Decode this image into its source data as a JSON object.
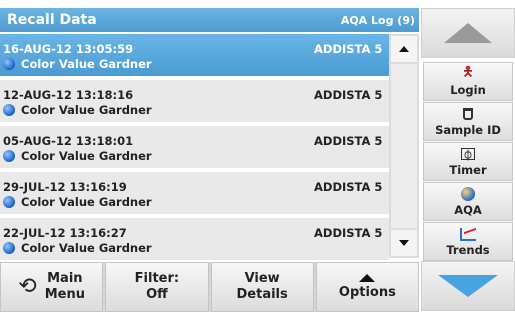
{
  "header": {
    "title": "Recall Data",
    "log": "AQA Log (9)"
  },
  "rows": [
    {
      "date": "16-AUG-12  13:05:59",
      "param": "Color Value Gardner",
      "sample": "ADDISTA 5",
      "selected": true
    },
    {
      "date": "12-AUG-12  13:18:16",
      "param": "Color Value Gardner",
      "sample": "ADDISTA 5",
      "selected": false
    },
    {
      "date": "05-AUG-12  13:18:01",
      "param": "Color Value Gardner",
      "sample": "ADDISTA 5",
      "selected": false
    },
    {
      "date": "29-JUL-12  13:16:19",
      "param": "Color Value Gardner",
      "sample": "ADDISTA 5",
      "selected": false
    },
    {
      "date": "22-JUL-12  13:16:27",
      "param": "Color Value Gardner",
      "sample": "ADDISTA 5",
      "selected": false
    }
  ],
  "bottom": {
    "main_menu_line1": "Main",
    "main_menu_line2": "Menu",
    "filter_line1": "Filter:",
    "filter_line2": "Off",
    "view_line1": "View",
    "view_line2": "Details",
    "options": "Options"
  },
  "side": {
    "login": "Login",
    "sample_id": "Sample ID",
    "timer": "Timer",
    "aqa": "AQA",
    "trends": "Trends"
  },
  "colors": {
    "accent": "#4e9bd0",
    "selected_row": "#5aa8dc",
    "row_bg": "#e9e9e9"
  }
}
